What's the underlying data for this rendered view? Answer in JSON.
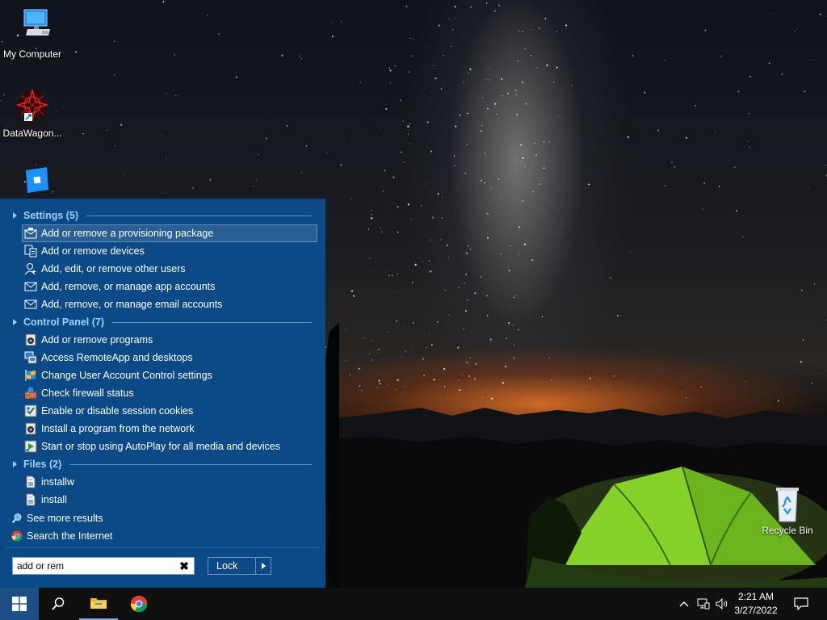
{
  "desktop": {
    "icons": [
      {
        "label": "My Computer",
        "icon": "computer-icon"
      },
      {
        "label": "DataWagon...",
        "icon": "datawagon-icon"
      },
      {
        "label": "Recycle Bin",
        "icon": "recycle-bin-icon"
      }
    ]
  },
  "start_menu": {
    "categories": [
      {
        "label": "Settings (5)",
        "items": [
          {
            "label": "Add or remove a provisioning package",
            "icon": "provisioning-package-icon",
            "selected": true
          },
          {
            "label": "Add or remove devices",
            "icon": "devices-icon"
          },
          {
            "label": "Add, edit, or remove other users",
            "icon": "user-icon"
          },
          {
            "label": "Add, remove, or manage app accounts",
            "icon": "mail-icon"
          },
          {
            "label": "Add, remove, or manage email accounts",
            "icon": "mail-icon"
          }
        ]
      },
      {
        "label": "Control Panel (7)",
        "items": [
          {
            "label": "Add or remove programs",
            "icon": "programs-icon"
          },
          {
            "label": "Access RemoteApp and desktops",
            "icon": "remoteapp-icon"
          },
          {
            "label": "Change User Account Control settings",
            "icon": "uac-flag-icon"
          },
          {
            "label": "Check firewall status",
            "icon": "firewall-icon"
          },
          {
            "label": "Enable or disable session cookies",
            "icon": "internet-options-icon"
          },
          {
            "label": "Install a program from the network",
            "icon": "programs-icon"
          },
          {
            "label": "Start or stop using AutoPlay for all media and devices",
            "icon": "autoplay-icon"
          }
        ]
      },
      {
        "label": "Files (2)",
        "items": [
          {
            "label": "installw",
            "icon": "file-icon"
          },
          {
            "label": "install",
            "icon": "file-icon"
          }
        ]
      }
    ],
    "see_more": "See more results",
    "search_internet": "Search the Internet",
    "search": {
      "value": "add or rem"
    },
    "lock_label": "Lock"
  },
  "taskbar": {
    "time": "2:21 AM",
    "date": "3/27/2022",
    "pinned": [
      "search-icon",
      "file-explorer-icon",
      "chrome-icon"
    ],
    "accent": "#1c4f86"
  }
}
